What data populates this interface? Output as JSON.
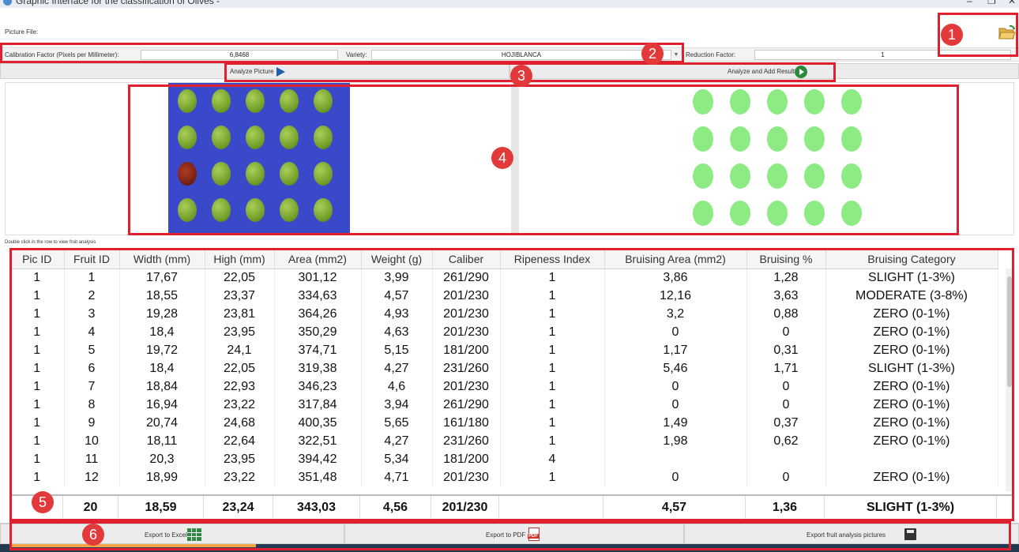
{
  "window": {
    "title": "Graphic Interface for the classification of Olives -",
    "controls": [
      "–",
      "❐",
      "✕"
    ]
  },
  "picture_file": {
    "label": "Picture File:",
    "value": ""
  },
  "calibration": {
    "label": "Calibration Factor (Pixels per Millimeter):",
    "value": "6,8468",
    "variety_label": "Variety:",
    "variety_value": "HOJIBLANCA",
    "reduction_label": "Reduction Factor:",
    "reduction_value": "1"
  },
  "actions": {
    "analyze_picture": "Analyze Picture",
    "analyze_and_add": "Analyze and Add Results"
  },
  "images": {
    "olive_grid": {
      "rows": 4,
      "cols": 5,
      "ripe_positions": [
        [
          2,
          0
        ]
      ]
    },
    "hint": "Double click in the row to view fruit analysis"
  },
  "table": {
    "columns": [
      "Pic ID",
      "Fruit ID",
      "Width (mm)",
      "High (mm)",
      "Area (mm2)",
      "Weight (g)",
      "Caliber",
      "Ripeness Index",
      "Bruising Area (mm2)",
      "Bruising %",
      "Bruising Category"
    ],
    "rows": [
      [
        "1",
        "1",
        "17,67",
        "22,05",
        "301,12",
        "3,99",
        "261/290",
        "1",
        "3,86",
        "1,28",
        "SLIGHT (1-3%)"
      ],
      [
        "1",
        "2",
        "18,55",
        "23,37",
        "334,63",
        "4,57",
        "201/230",
        "1",
        "12,16",
        "3,63",
        "MODERATE (3-8%)"
      ],
      [
        "1",
        "3",
        "19,28",
        "23,81",
        "364,26",
        "4,93",
        "201/230",
        "1",
        "3,2",
        "0,88",
        "ZERO (0-1%)"
      ],
      [
        "1",
        "4",
        "18,4",
        "23,95",
        "350,29",
        "4,63",
        "201/230",
        "1",
        "0",
        "0",
        "ZERO (0-1%)"
      ],
      [
        "1",
        "5",
        "19,72",
        "24,1",
        "374,71",
        "5,15",
        "181/200",
        "1",
        "1,17",
        "0,31",
        "ZERO (0-1%)"
      ],
      [
        "1",
        "6",
        "18,4",
        "22,05",
        "319,38",
        "4,27",
        "231/260",
        "1",
        "5,46",
        "1,71",
        "SLIGHT (1-3%)"
      ],
      [
        "1",
        "7",
        "18,84",
        "22,93",
        "346,23",
        "4,6",
        "201/230",
        "1",
        "0",
        "0",
        "ZERO (0-1%)"
      ],
      [
        "1",
        "8",
        "16,94",
        "23,22",
        "317,84",
        "3,94",
        "261/290",
        "1",
        "0",
        "0",
        "ZERO (0-1%)"
      ],
      [
        "1",
        "9",
        "20,74",
        "24,68",
        "400,35",
        "5,65",
        "161/180",
        "1",
        "1,49",
        "0,37",
        "ZERO (0-1%)"
      ],
      [
        "1",
        "10",
        "18,11",
        "22,64",
        "322,51",
        "4,27",
        "231/260",
        "1",
        "1,98",
        "0,62",
        "ZERO (0-1%)"
      ],
      [
        "1",
        "11",
        "20,3",
        "23,95",
        "394,42",
        "5,34",
        "181/200",
        "4",
        "",
        "",
        ""
      ],
      [
        "1",
        "12",
        "18,99",
        "23,22",
        "351,48",
        "4,71",
        "201/230",
        "1",
        "0",
        "0",
        "ZERO (0-1%)"
      ]
    ],
    "totals": [
      "",
      "20",
      "18,59",
      "23,24",
      "343,03",
      "4,56",
      "201/230",
      "",
      "4,57",
      "1,36",
      "SLIGHT (1-3%)"
    ]
  },
  "export": {
    "excel": "Export to Excell",
    "pdf": "Export to PDF",
    "pictures": "Export fruit analysis pictures"
  },
  "annotations": [
    "1",
    "2",
    "3",
    "4",
    "5",
    "6"
  ],
  "colors": {
    "annotation_red": "#e0202e",
    "olive_background_blue": "#3a49c9",
    "segmentation_green": "#8deb83",
    "play_blue": "#1f5fa8",
    "play_green": "#2e8b3e"
  }
}
